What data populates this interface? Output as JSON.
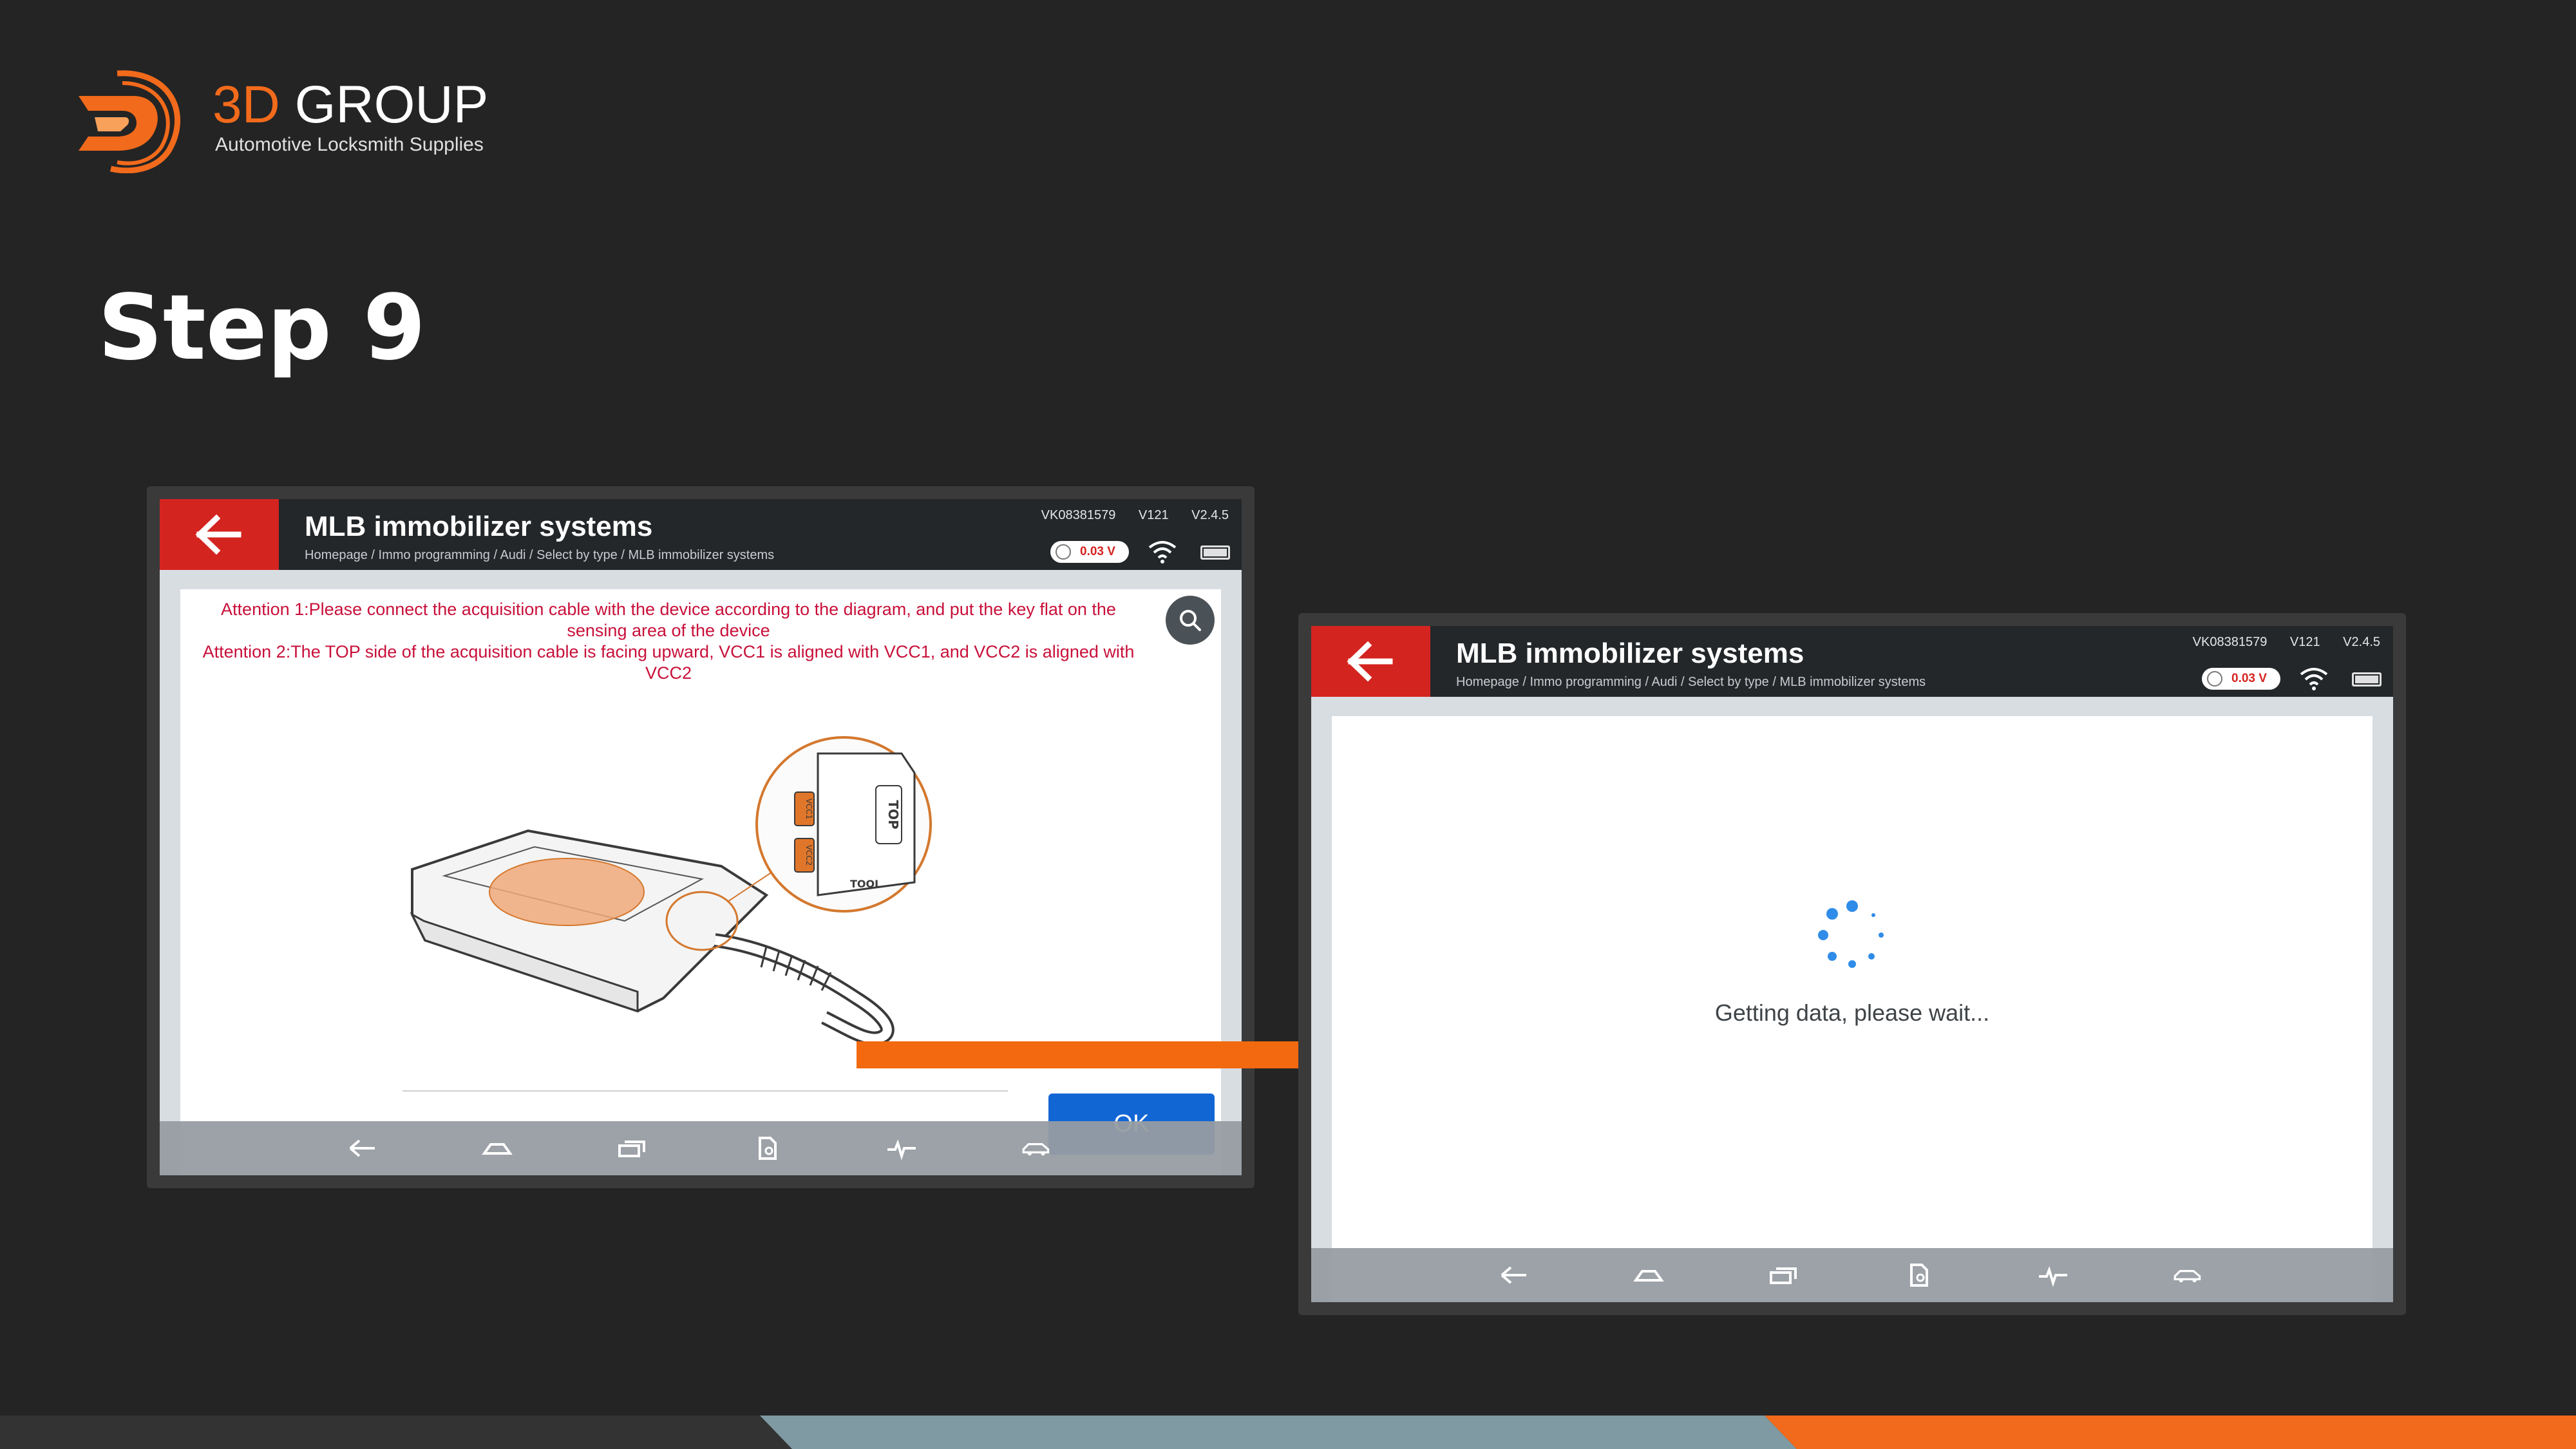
{
  "brand": {
    "name_accent": "3D",
    "name_rest": "GROUP",
    "tagline": "Automotive Locksmith Supplies",
    "accent_color": "#f26a1b"
  },
  "step_title": "Step 9",
  "screen_common": {
    "title": "MLB immobilizer systems",
    "breadcrumb": "Homepage / Immo programming / Audi / Select by type / MLB immobilizer systems",
    "serial": "VK08381579",
    "hw_version": "V121",
    "sw_version": "V2.4.5",
    "voltage": "0.03 V",
    "header_color": "#23272a",
    "back_color": "#d42420"
  },
  "left_screen": {
    "attention_lines": [
      "Attention 1:Please connect the acquisition cable with the device according to the diagram, and put the key flat on the sensing area of the device",
      "Attention 2:The TOP side of the acquisition cable is facing upward, VCC1 is aligned with VCC1, and VCC2 is aligned with VCC2"
    ],
    "diagram_labels": {
      "vcc1": "VCC1",
      "vcc2": "VCC2",
      "top": "TOP",
      "tool": "TOOL"
    },
    "ok_label": "OK",
    "ok_color": "#1266d4"
  },
  "right_screen": {
    "loading_text": "Getting data, please wait...",
    "spinner_color": "#2f8ce8"
  },
  "nav_icons": [
    "back-arrow-icon",
    "home-icon",
    "recent-apps-icon",
    "file-search-icon",
    "waveform-icon",
    "car-icon"
  ],
  "transition_arrow_color": "#f2690f",
  "footer_colors": [
    "#333333",
    "#7f9aa3",
    "#f26a1b"
  ]
}
